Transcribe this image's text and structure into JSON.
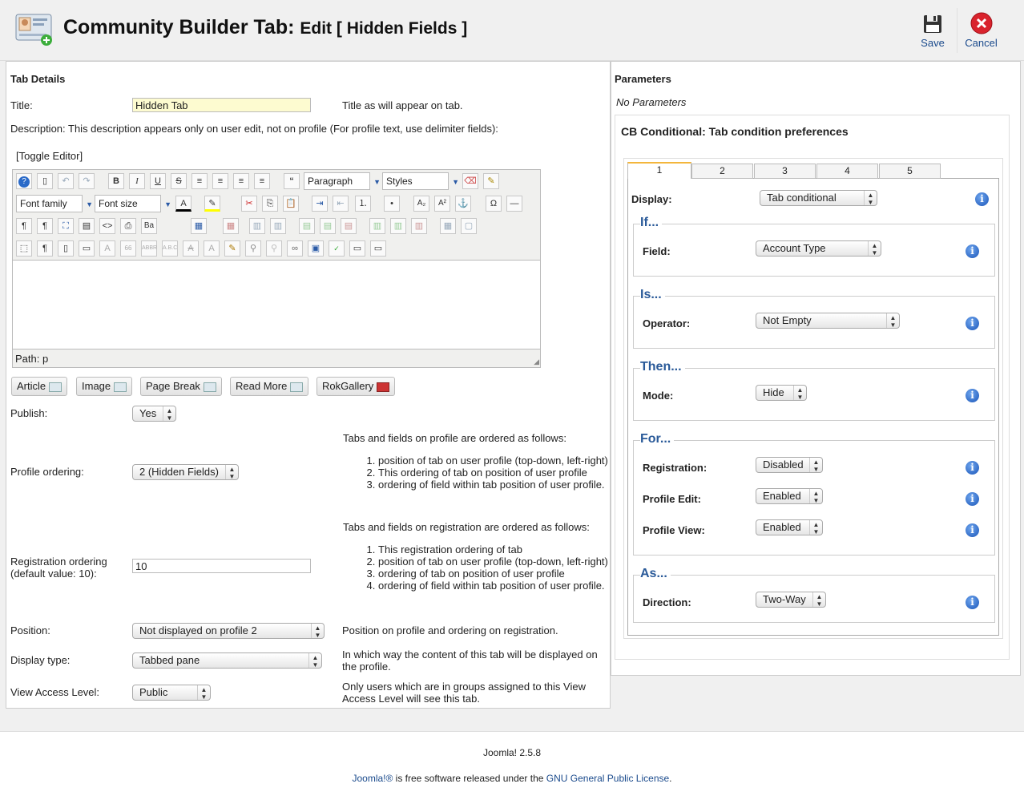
{
  "header": {
    "title_main": "Community Builder Tab:",
    "title_sub": "Edit [ Hidden Fields ]",
    "save_label": "Save",
    "cancel_label": "Cancel"
  },
  "tab_details": {
    "heading": "Tab Details",
    "title_label": "Title:",
    "title_value": "Hidden Tab",
    "title_help": "Title as will appear on tab.",
    "description_label": "Description: This description appears only on user edit, not on profile (For profile text, use delimiter fields):",
    "toggle_editor": "[Toggle Editor]",
    "editor": {
      "paragraph": "Paragraph",
      "styles": "Styles",
      "font_family": "Font family",
      "font_size": "Font size",
      "path_label": "Path:",
      "path_value": "p"
    },
    "editor_buttons": [
      "Article",
      "Image",
      "Page Break",
      "Read More",
      "RokGallery"
    ],
    "publish_label": "Publish:",
    "publish_value": "Yes",
    "profile_ordering_label": "Profile ordering:",
    "profile_ordering_value": "2 (Hidden Fields)",
    "profile_ordering_help_title": "Tabs and fields on profile are ordered as follows:",
    "profile_ordering_help_items": [
      "position of tab on user profile (top-down, left-right)",
      "This ordering of tab on position of user profile",
      "ordering of field within tab position of user profile."
    ],
    "registration_ordering_label": "Registration ordering (default value: 10):",
    "registration_ordering_value": "10",
    "registration_help_title": "Tabs and fields on registration are ordered as follows:",
    "registration_help_items": [
      "This registration ordering of tab",
      "position of tab on user profile (top-down, left-right)",
      "ordering of tab on position of user profile",
      "ordering of field within tab position of user profile."
    ],
    "position_label": "Position:",
    "position_value": "Not displayed on profile 2",
    "position_help": "Position on profile and ordering on registration.",
    "display_type_label": "Display type:",
    "display_type_value": "Tabbed pane",
    "display_type_help": "In which way the content of this tab will be displayed on the profile.",
    "access_label": "View Access Level:",
    "access_value": "Public",
    "access_help": "Only users which are in groups assigned to this View Access Level will see this tab."
  },
  "parameters": {
    "heading": "Parameters",
    "none_text": "No Parameters",
    "cb_heading": "CB Conditional: Tab condition preferences",
    "tabs": [
      "1",
      "2",
      "3",
      "4",
      "5"
    ],
    "display_label": "Display:",
    "display_value": "Tab conditional",
    "if_legend": "If...",
    "field_label": "Field:",
    "field_value": "Account Type",
    "is_legend": "Is...",
    "operator_label": "Operator:",
    "operator_value": "Not Empty",
    "then_legend": "Then...",
    "mode_label": "Mode:",
    "mode_value": "Hide",
    "for_legend": "For...",
    "registration_label": "Registration:",
    "registration_value": "Disabled",
    "profile_edit_label": "Profile Edit:",
    "profile_edit_value": "Enabled",
    "profile_view_label": "Profile View:",
    "profile_view_value": "Enabled",
    "as_legend": "As...",
    "direction_label": "Direction:",
    "direction_value": "Two-Way"
  },
  "footer": {
    "version": "Joomla! 2.5.8",
    "license_link1": "Joomla!®",
    "license_text": " is free software released under the ",
    "license_link2": "GNU General Public License",
    "license_end": "."
  },
  "colors": {
    "accent_blue": "#2a5a99",
    "title_input_bg": "#fdfbd0",
    "tab_active_border": "#f3b63c"
  }
}
